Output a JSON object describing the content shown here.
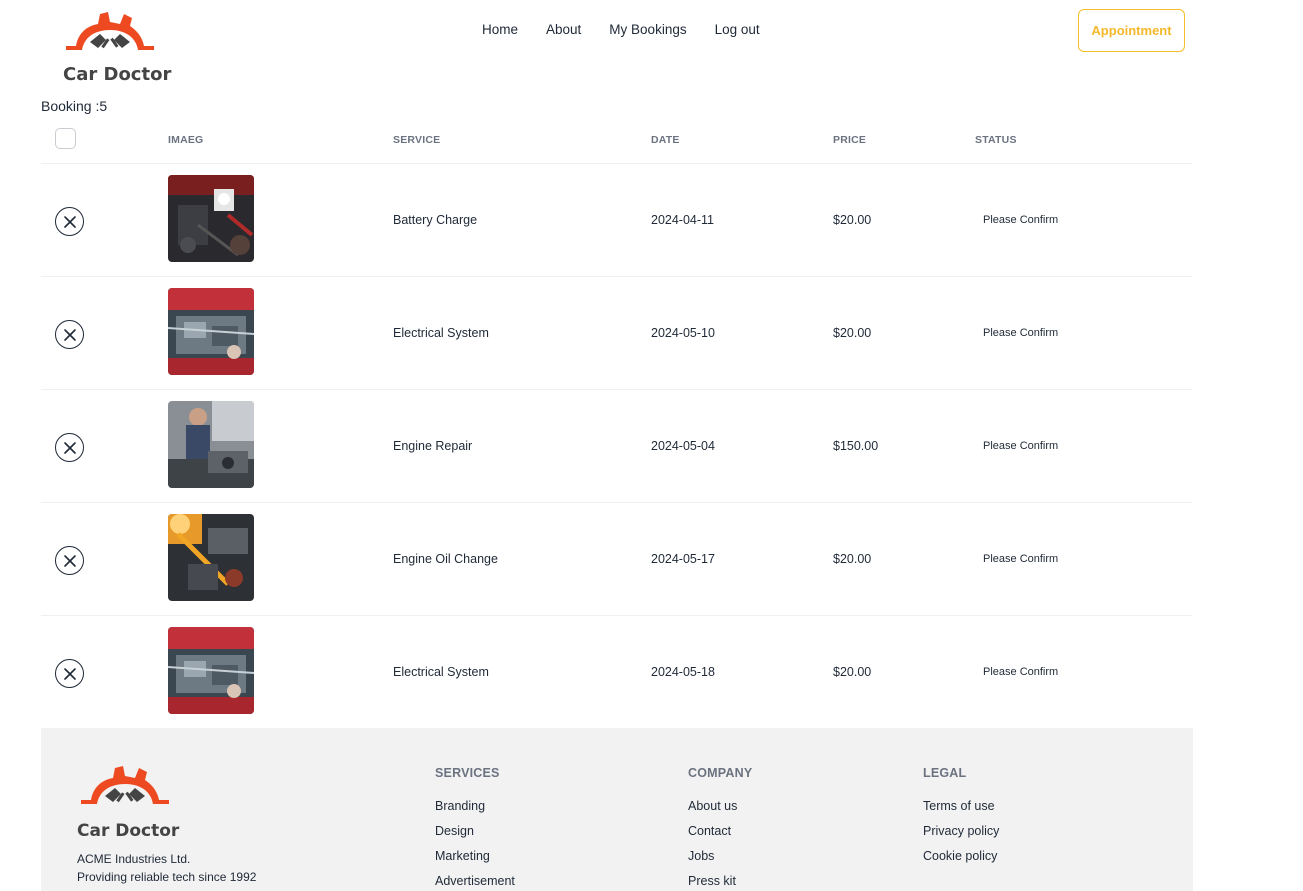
{
  "brand": {
    "name": "Car Doctor",
    "logo_color": "#ee4a21"
  },
  "nav": {
    "home": "Home",
    "about": "About",
    "bookings": "My Bookings",
    "logout": "Log out"
  },
  "appointment_label": "Appointment",
  "booking_count": "Booking :5",
  "table": {
    "headers": {
      "image": "IMAEG",
      "service": "SERVICE",
      "date": "DATE",
      "price": "PRICE",
      "status": "STATUS"
    },
    "rows": [
      {
        "service": "Battery Charge",
        "date": "2024-04-11",
        "price": "$20.00",
        "status": "Please Confirm",
        "image": "battery-charge-photo"
      },
      {
        "service": "Electrical System",
        "date": "2024-05-10",
        "price": "$20.00",
        "status": "Please Confirm",
        "image": "electrical-system-photo"
      },
      {
        "service": "Engine Repair",
        "date": "2024-05-04",
        "price": "$150.00",
        "status": "Please Confirm",
        "image": "engine-repair-photo"
      },
      {
        "service": "Engine Oil Change",
        "date": "2024-05-17",
        "price": "$20.00",
        "status": "Please Confirm",
        "image": "engine-oil-change-photo"
      },
      {
        "service": "Electrical System",
        "date": "2024-05-18",
        "price": "$20.00",
        "status": "Please Confirm",
        "image": "electrical-system-photo"
      }
    ]
  },
  "footer": {
    "brand": "Car Doctor",
    "tagline1": "ACME Industries Ltd.",
    "tagline2": "Providing reliable tech since 1992",
    "services": {
      "title": "SERVICES",
      "items": [
        "Branding",
        "Design",
        "Marketing",
        "Advertisement"
      ]
    },
    "company": {
      "title": "COMPANY",
      "items": [
        "About us",
        "Contact",
        "Jobs",
        "Press kit"
      ]
    },
    "legal": {
      "title": "LEGAL",
      "items": [
        "Terms of use",
        "Privacy policy",
        "Cookie policy"
      ]
    }
  }
}
